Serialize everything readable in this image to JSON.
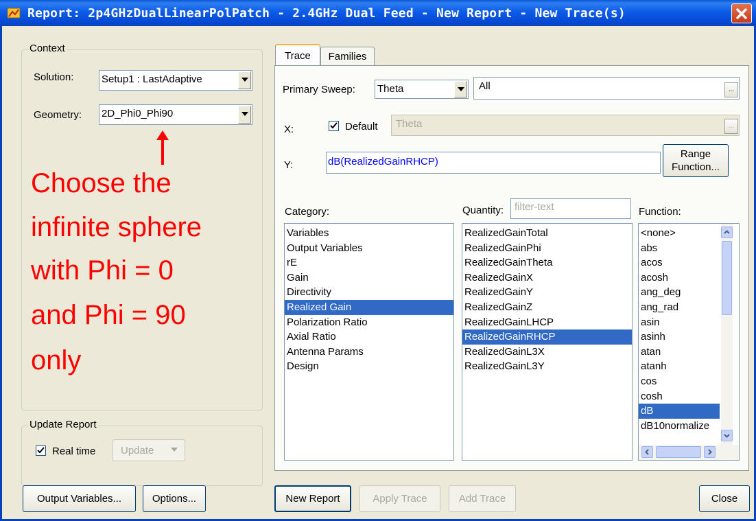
{
  "window": {
    "title": "Report: 2p4GHzDualLinearPolPatch - 2.4GHz Dual Feed - New Report - New Trace(s)"
  },
  "context": {
    "legend": "Context",
    "solution_label": "Solution:",
    "solution_value": "Setup1 : LastAdaptive",
    "geometry_label": "Geometry:",
    "geometry_value": "2D_Phi0_Phi90"
  },
  "annotation": {
    "lines": [
      "Choose the",
      "infinite sphere",
      "with Phi = 0",
      "and Phi = 90",
      "only"
    ],
    "color": "#ff0000"
  },
  "update_report": {
    "legend": "Update Report",
    "realtime_label": "Real time",
    "realtime_checked": true,
    "update_label": "Update"
  },
  "tabs": [
    {
      "label": "Trace",
      "active": true
    },
    {
      "label": "Families",
      "active": false
    }
  ],
  "trace": {
    "primary_sweep_label": "Primary Sweep:",
    "primary_sweep_value": "Theta",
    "sweep_range": "All",
    "x_label": "X:",
    "default_label": "Default",
    "default_checked": true,
    "x_value": "Theta",
    "y_label": "Y:",
    "y_value": "dB(RealizedGainRHCP)",
    "range_function_label_1": "Range",
    "range_function_label_2": "Function...",
    "ellipsis": "..."
  },
  "category": {
    "label": "Category:",
    "items": [
      "Variables",
      "Output Variables",
      "rE",
      "Gain",
      "Directivity",
      "Realized Gain",
      "Polarization Ratio",
      "Axial Ratio",
      "Antenna Params",
      "Design"
    ],
    "selected": "Realized Gain"
  },
  "quantity": {
    "label": "Quantity:",
    "filter_placeholder": "filter-text",
    "items": [
      "RealizedGainTotal",
      "RealizedGainPhi",
      "RealizedGainTheta",
      "RealizedGainX",
      "RealizedGainY",
      "RealizedGainZ",
      "RealizedGainLHCP",
      "RealizedGainRHCP",
      "RealizedGainL3X",
      "RealizedGainL3Y"
    ],
    "selected": "RealizedGainRHCP"
  },
  "function": {
    "label": "Function:",
    "items": [
      "<none>",
      "abs",
      "acos",
      "acosh",
      "ang_deg",
      "ang_rad",
      "asin",
      "asinh",
      "atan",
      "atanh",
      "cos",
      "cosh",
      "dB",
      "dB10normalize"
    ],
    "selected": "dB"
  },
  "buttons": {
    "output_variables": "Output Variables...",
    "options": "Options...",
    "new_report": "New Report",
    "apply_trace": "Apply Trace",
    "add_trace": "Add Trace",
    "close": "Close"
  },
  "colors": {
    "selection": "#316ac5",
    "title_bar": "#0a5ad6",
    "y_expression": "#0000ff",
    "annotation": "#ff0000"
  }
}
